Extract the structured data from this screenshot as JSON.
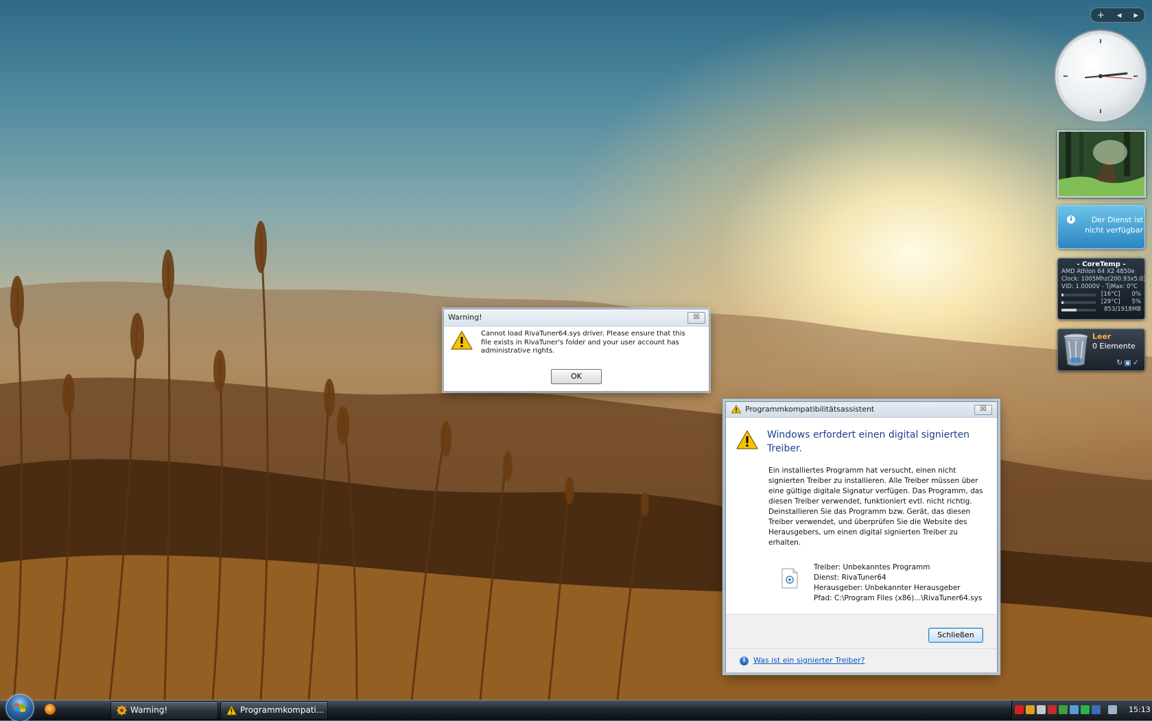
{
  "sidebar": {
    "control_add": "+",
    "control_prev": "◂",
    "control_next": "▸",
    "weather": {
      "message": "Der Dienst ist nicht verfügbar",
      "icon": "info-icon"
    },
    "coretemp": {
      "title": "- CoreTemp -",
      "cpu": "AMD Athlon 64 X2 4850e",
      "clock": "Clock: 1005Mhz(200.93x5.0)",
      "vid": "VID: 1.0000V - TjMax: 0°C",
      "core0_temp": "[16°C]",
      "core0_load": "0%",
      "core0_fill": 0.05,
      "core1_temp": "[29°C]",
      "core1_load": "5%",
      "core1_fill": 0.05,
      "memory": "853/1918MB",
      "memory_fill": 0.44
    },
    "recycle_bin": {
      "state": "Leer",
      "count": "0 Elemente"
    }
  },
  "warning_dialog": {
    "title": "Warning!",
    "message": "Cannot load RivaTuner64.sys driver. Please ensure that this file exists in RivaTuner's folder and your user account has administrative rights.",
    "ok_label": "OK",
    "close_glyph": "☒"
  },
  "pca_dialog": {
    "title": "Programmkompatibilitätsassistent",
    "heading": "Windows erfordert einen digital signierten Treiber.",
    "paragraph1": "Ein installiertes Programm hat versucht, einen nicht signierten Treiber zu installieren. Alle Treiber müssen über eine gültige digitale Signatur verfügen. Das Programm, das diesen Treiber verwendet, funktioniert evtl. nicht richtig.",
    "paragraph2": "Deinstallieren Sie das Programm bzw. Gerät, das diesen Treiber verwendet, und überprüfen Sie die Website des Herausgebers, um einen digital signierten Treiber zu erhalten.",
    "details": {
      "treiber": "Treiber: Unbekanntes Programm",
      "dienst": "Dienst: RivaTuner64",
      "herausgeber": "Herausgeber: Unbekannter Herausgeber",
      "pfad": "Pfad: C:\\Program Files (x86)...\\RivaTuner64.sys"
    },
    "close_label": "Schließen",
    "help_link": "Was ist ein signierter Treiber?",
    "close_glyph": "☒"
  },
  "taskbar": {
    "tasks": [
      {
        "label": "Warning!",
        "icon": "warning-app-icon"
      },
      {
        "label": "Programmkompati...",
        "icon": "warning-icon"
      }
    ],
    "clock": "15:13"
  },
  "colors": {
    "heading_blue": "#1b3f8b",
    "link_blue": "#0c54c4",
    "bin_accent": "#ffb13b"
  }
}
